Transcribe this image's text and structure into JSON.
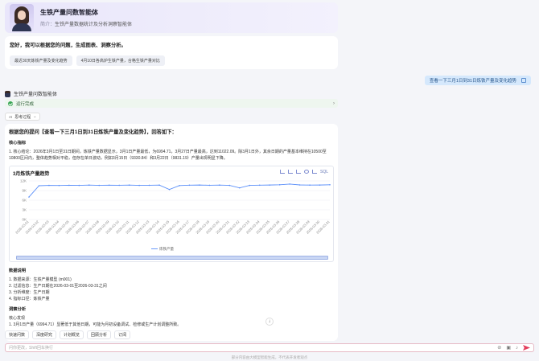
{
  "agent": {
    "title": "生铁产量问数智能体",
    "intro_label": "简介：",
    "intro": "生铁产量数据统计及分析洞察智能体"
  },
  "welcome": {
    "text": "您好，我可以根据您的问题，生成图表、洞察分析。",
    "chips": [
      "最近30天炼铁产量及变化趋势",
      "4月10日各高炉生铁产量，合格生铁产量对比"
    ]
  },
  "user_message": "查看一下三月1日到31日炼铁产量及变化趋势",
  "bot": {
    "name": "生铁产量问数智能体",
    "run_status": "运行完成",
    "think_label": "思考过程"
  },
  "answer": {
    "title": "根据您的提问【查看一下三月1日到31日炼铁产量及变化趋势】，回答如下：",
    "core_heading": "核心指标",
    "core_text_a": "1. 核心结论：2026年3月1日至31日期间，炼铁产量数据显示，3月1日产量最低，为6994.71，3月27日产量最高，达到11022.09。除3月1日外，其余日期的产量基本维持在105",
    "core_text_b": "00至10800区间内，整体趋势相对平稳，但存在单日波动，例如3月15日（9330.84）和3月22日（9831.19）产量出现明显下降。",
    "chart_title": "3月炼铁产量趋势",
    "sql_label": "SQL",
    "desc_heading": "数据说明",
    "desc": [
      "1. 数据来源：生铁产量模型 (m001)",
      "2. 过滤信息：生产日期在2026-03-01至2026-03-31之间",
      "3. 分析维度：生产日期",
      "4. 指标口径：炼铁产量"
    ],
    "insight_heading": "洞察分析",
    "insight_sub": "核心发现",
    "insight_1": "1. 3月1日产量（6994.71）显著低于其他日期，可能为月初设备调试、检修或生产计划调整所致。"
  },
  "bottom_tabs": [
    "快速问数",
    "深度研究",
    "计划概览",
    "回顾分析",
    "订阅"
  ],
  "input_placeholder": "问你更改，Shift回车换行",
  "disclaimer": "部分内容由大模型智能生成，不代表开发者观点",
  "colors": {
    "accent": "#5b8ff9",
    "send": "#e33e5d"
  },
  "chart_data": {
    "type": "line",
    "title": "3月炼铁产量趋势",
    "series": [
      {
        "name": "炼铁产量",
        "values": [
          6994.71,
          10500,
          10620,
          10580,
          10650,
          10600,
          10700,
          10620,
          10680,
          10650,
          10700,
          10600,
          10650,
          10700,
          9330.84,
          10550,
          10680,
          10720,
          10650,
          10700,
          10600,
          9831.19,
          10600,
          10680,
          10720,
          10800,
          11022.09,
          10750,
          10700,
          10720,
          10800
        ]
      }
    ],
    "categories": [
      "2026-03-01",
      "2026-03-02",
      "2026-03-03",
      "2026-03-04",
      "2026-03-05",
      "2026-03-06",
      "2026-03-07",
      "2026-03-08",
      "2026-03-09",
      "2026-03-10",
      "2026-03-11",
      "2026-03-12",
      "2026-03-13",
      "2026-03-14",
      "2026-03-15",
      "2026-03-16",
      "2026-03-17",
      "2026-03-18",
      "2026-03-19",
      "2026-03-20",
      "2026-03-21",
      "2026-03-22",
      "2026-03-23",
      "2026-03-24",
      "2026-03-25",
      "2026-03-26",
      "2026-03-27",
      "2026-03-28",
      "2026-03-29",
      "2026-03-30",
      "2026-03-31"
    ],
    "yticks": [
      "0K",
      "3K",
      "6K",
      "9K",
      "12K"
    ],
    "ylim": [
      0,
      12000
    ],
    "grid": true,
    "legend": "bottom-center"
  }
}
